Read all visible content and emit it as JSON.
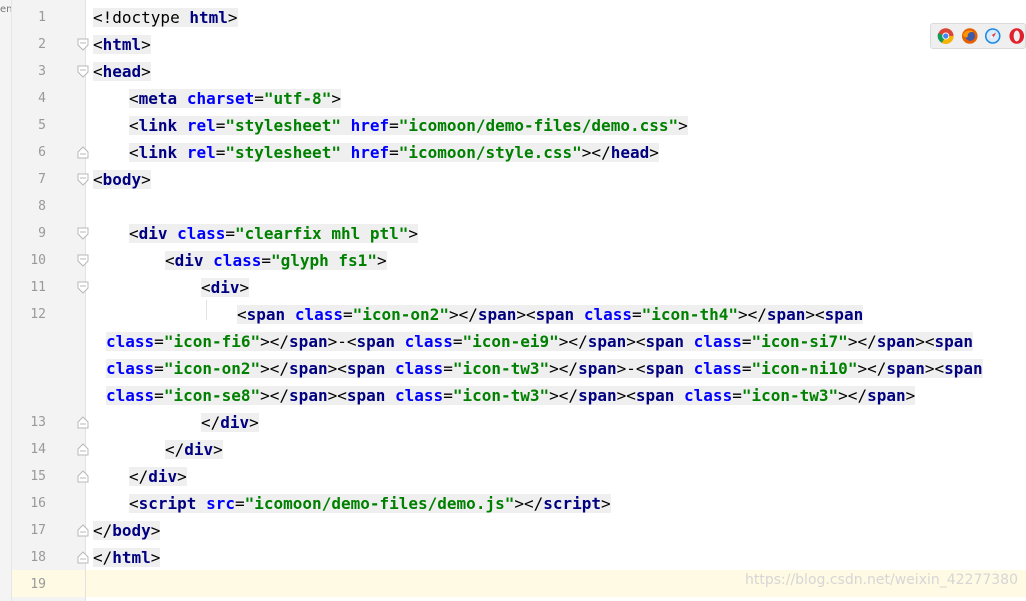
{
  "left_edge_text": "en",
  "browser_icons": [
    "chrome-icon",
    "firefox-icon",
    "safari-icon",
    "opera-icon"
  ],
  "watermark": "https://blog.csdn.net/weixin_42277380",
  "lines": [
    {
      "n": "1",
      "segs": [
        [
          "plain",
          "<!doctype "
        ],
        [
          "tag",
          "html"
        ],
        [
          "plain",
          ">"
        ]
      ]
    },
    {
      "n": "2",
      "segs": [
        [
          "plain",
          "<"
        ],
        [
          "tag",
          "html"
        ],
        [
          "plain",
          ">"
        ]
      ]
    },
    {
      "n": "3",
      "segs": [
        [
          "plain",
          "<"
        ],
        [
          "tag",
          "head"
        ],
        [
          "plain",
          ">"
        ]
      ]
    },
    {
      "n": "4",
      "segs": [
        [
          "plain",
          "<"
        ],
        [
          "tag",
          "meta "
        ],
        [
          "attr",
          "charset"
        ],
        [
          "plain",
          "="
        ],
        [
          "val",
          "\"utf-8\""
        ],
        [
          "plain",
          ">"
        ]
      ]
    },
    {
      "n": "5",
      "segs": [
        [
          "plain",
          "<"
        ],
        [
          "tag",
          "link "
        ],
        [
          "attr",
          "rel"
        ],
        [
          "plain",
          "="
        ],
        [
          "val",
          "\"stylesheet\" "
        ],
        [
          "attr",
          "href"
        ],
        [
          "plain",
          "="
        ],
        [
          "val",
          "\"icomoon/demo-files/demo.css\""
        ],
        [
          "plain",
          ">"
        ]
      ]
    },
    {
      "n": "6",
      "segs": [
        [
          "plain",
          "<"
        ],
        [
          "tag",
          "link "
        ],
        [
          "attr",
          "rel"
        ],
        [
          "plain",
          "="
        ],
        [
          "val",
          "\"stylesheet\" "
        ],
        [
          "attr",
          "href"
        ],
        [
          "plain",
          "="
        ],
        [
          "val",
          "\"icomoon/style.css\""
        ],
        [
          "plain",
          "></"
        ],
        [
          "tag",
          "head"
        ],
        [
          "plain",
          ">"
        ]
      ]
    },
    {
      "n": "7",
      "segs": [
        [
          "plain",
          "<"
        ],
        [
          "tag",
          "body"
        ],
        [
          "plain",
          ">"
        ]
      ]
    },
    {
      "n": "8",
      "segs": []
    },
    {
      "n": "9",
      "segs": [
        [
          "plain",
          "<"
        ],
        [
          "tag",
          "div "
        ],
        [
          "attr",
          "class"
        ],
        [
          "plain",
          "="
        ],
        [
          "val",
          "\"clearfix mhl ptl\""
        ],
        [
          "plain",
          ">"
        ]
      ]
    },
    {
      "n": "10",
      "segs": [
        [
          "plain",
          "<"
        ],
        [
          "tag",
          "div "
        ],
        [
          "attr",
          "class"
        ],
        [
          "plain",
          "="
        ],
        [
          "val",
          "\"glyph fs1\""
        ],
        [
          "plain",
          ">"
        ]
      ]
    },
    {
      "n": "11",
      "segs": [
        [
          "plain",
          "<"
        ],
        [
          "tag",
          "div"
        ],
        [
          "plain",
          ">"
        ]
      ]
    },
    {
      "n": "12",
      "segs": [
        [
          "plain",
          "<"
        ],
        [
          "tag",
          "span "
        ],
        [
          "attr",
          "class"
        ],
        [
          "plain",
          "="
        ],
        [
          "val",
          "\"icon-on2\""
        ],
        [
          "plain",
          "></"
        ],
        [
          "tag",
          "span"
        ],
        [
          "plain",
          "><"
        ],
        [
          "tag",
          "span "
        ],
        [
          "attr",
          "class"
        ],
        [
          "plain",
          "="
        ],
        [
          "val",
          "\"icon-th4\""
        ],
        [
          "plain",
          "></"
        ],
        [
          "tag",
          "span"
        ],
        [
          "plain",
          "><"
        ],
        [
          "tag",
          "span"
        ]
      ]
    },
    {
      "n": "",
      "segs": [
        [
          "attr",
          "class"
        ],
        [
          "plain",
          "="
        ],
        [
          "val",
          "\"icon-fi6\""
        ],
        [
          "plain",
          "></"
        ],
        [
          "tag",
          "span"
        ],
        [
          "plain",
          ">-<"
        ],
        [
          "tag",
          "span "
        ],
        [
          "attr",
          "class"
        ],
        [
          "plain",
          "="
        ],
        [
          "val",
          "\"icon-ei9\""
        ],
        [
          "plain",
          "></"
        ],
        [
          "tag",
          "span"
        ],
        [
          "plain",
          "><"
        ],
        [
          "tag",
          "span "
        ],
        [
          "attr",
          "class"
        ],
        [
          "plain",
          "="
        ],
        [
          "val",
          "\"icon-si7\""
        ],
        [
          "plain",
          "></"
        ],
        [
          "tag",
          "span"
        ],
        [
          "plain",
          "><"
        ],
        [
          "tag",
          "span"
        ]
      ]
    },
    {
      "n": "",
      "segs": [
        [
          "attr",
          "class"
        ],
        [
          "plain",
          "="
        ],
        [
          "val",
          "\"icon-on2\""
        ],
        [
          "plain",
          "></"
        ],
        [
          "tag",
          "span"
        ],
        [
          "plain",
          "><"
        ],
        [
          "tag",
          "span "
        ],
        [
          "attr",
          "class"
        ],
        [
          "plain",
          "="
        ],
        [
          "val",
          "\"icon-tw3\""
        ],
        [
          "plain",
          "></"
        ],
        [
          "tag",
          "span"
        ],
        [
          "plain",
          ">-<"
        ],
        [
          "tag",
          "span "
        ],
        [
          "attr",
          "class"
        ],
        [
          "plain",
          "="
        ],
        [
          "val",
          "\"icon-ni10\""
        ],
        [
          "plain",
          "></"
        ],
        [
          "tag",
          "span"
        ],
        [
          "plain",
          "><"
        ],
        [
          "tag",
          "span"
        ]
      ]
    },
    {
      "n": "",
      "segs": [
        [
          "attr",
          "class"
        ],
        [
          "plain",
          "="
        ],
        [
          "val",
          "\"icon-se8\""
        ],
        [
          "plain",
          "></"
        ],
        [
          "tag",
          "span"
        ],
        [
          "plain",
          "><"
        ],
        [
          "tag",
          "span "
        ],
        [
          "attr",
          "class"
        ],
        [
          "plain",
          "="
        ],
        [
          "val",
          "\"icon-tw3\""
        ],
        [
          "plain",
          "></"
        ],
        [
          "tag",
          "span"
        ],
        [
          "plain",
          "><"
        ],
        [
          "tag",
          "span "
        ],
        [
          "attr",
          "class"
        ],
        [
          "plain",
          "="
        ],
        [
          "val",
          "\"icon-tw3\""
        ],
        [
          "plain",
          "></"
        ],
        [
          "tag",
          "span"
        ],
        [
          "plain",
          ">"
        ]
      ]
    },
    {
      "n": "13",
      "segs": [
        [
          "plain",
          "</"
        ],
        [
          "tag",
          "div"
        ],
        [
          "plain",
          ">"
        ]
      ]
    },
    {
      "n": "14",
      "segs": [
        [
          "plain",
          "</"
        ],
        [
          "tag",
          "div"
        ],
        [
          "plain",
          ">"
        ]
      ]
    },
    {
      "n": "15",
      "segs": [
        [
          "plain",
          "</"
        ],
        [
          "tag",
          "div"
        ],
        [
          "plain",
          ">"
        ]
      ]
    },
    {
      "n": "16",
      "segs": [
        [
          "plain",
          "<"
        ],
        [
          "tag",
          "script "
        ],
        [
          "attr",
          "src"
        ],
        [
          "plain",
          "="
        ],
        [
          "val",
          "\"icomoon/demo-files/demo.js\""
        ],
        [
          "plain",
          "></"
        ],
        [
          "tag",
          "script"
        ],
        [
          "plain",
          ">"
        ]
      ]
    },
    {
      "n": "17",
      "segs": [
        [
          "plain",
          "</"
        ],
        [
          "tag",
          "body"
        ],
        [
          "plain",
          ">"
        ]
      ]
    },
    {
      "n": "18",
      "segs": [
        [
          "plain",
          "</"
        ],
        [
          "tag",
          "html"
        ],
        [
          "plain",
          ">"
        ]
      ]
    },
    {
      "n": "19",
      "segs": []
    }
  ]
}
